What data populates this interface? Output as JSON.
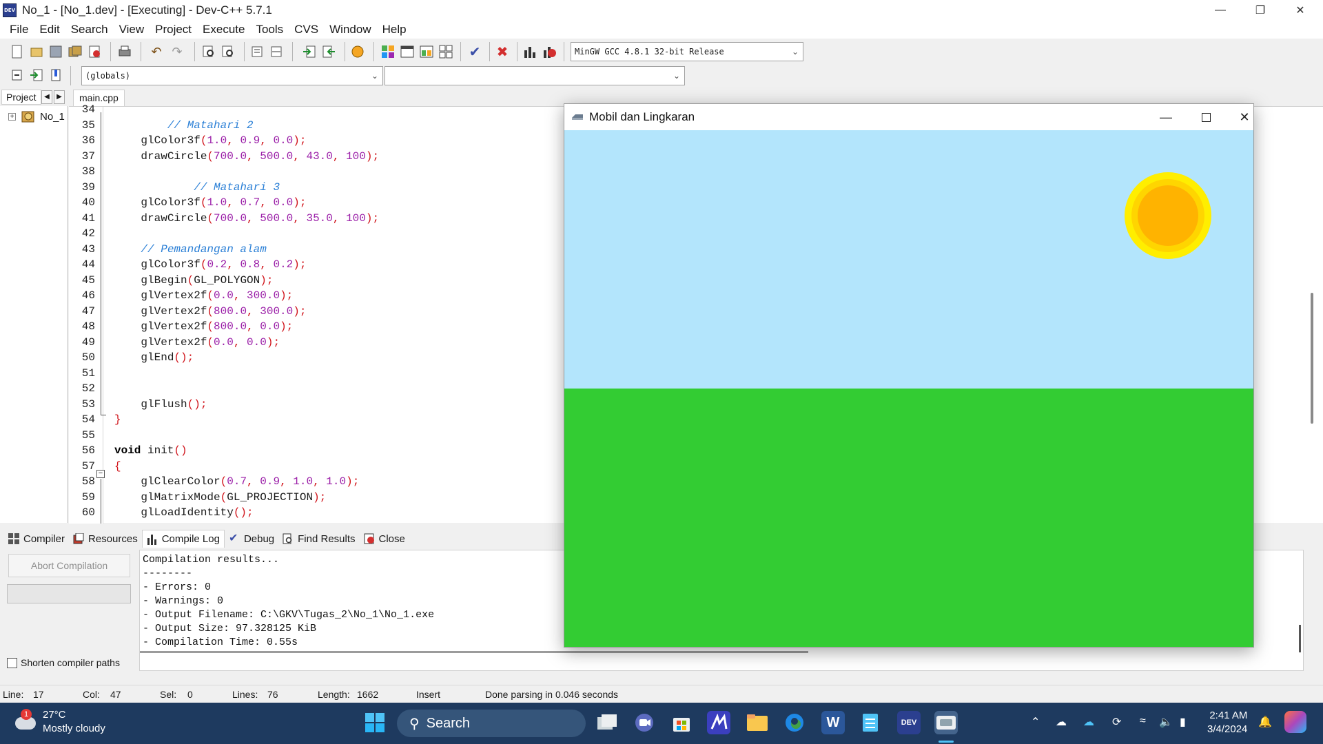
{
  "window": {
    "title": "No_1 - [No_1.dev] - [Executing] - Dev-C++ 5.7.1",
    "app_icon_text": "DEV"
  },
  "menu": [
    "File",
    "Edit",
    "Search",
    "View",
    "Project",
    "Execute",
    "Tools",
    "CVS",
    "Window",
    "Help"
  ],
  "toolbar": {
    "compiler_select": "MinGW GCC 4.8.1 32-bit Release",
    "scope_select": "(globals)",
    "member_select": ""
  },
  "project_panel": {
    "tab_label": "Project",
    "tree_root": "No_1"
  },
  "editor": {
    "tab_label": "main.cpp",
    "lines": [
      {
        "n": "34",
        "parts": []
      },
      {
        "n": "35",
        "parts": [
          {
            "t": "        // Matahari 2",
            "c": "cmt"
          }
        ]
      },
      {
        "n": "36",
        "parts": [
          {
            "t": "    glColor3f",
            "c": ""
          },
          {
            "t": "(",
            "c": "sym"
          },
          {
            "t": "1.0",
            "c": "num"
          },
          {
            "t": ", ",
            "c": "sym"
          },
          {
            "t": "0.9",
            "c": "num"
          },
          {
            "t": ", ",
            "c": "sym"
          },
          {
            "t": "0.0",
            "c": "num"
          },
          {
            "t": ");",
            "c": "sym"
          }
        ]
      },
      {
        "n": "37",
        "parts": [
          {
            "t": "    drawCircle",
            "c": ""
          },
          {
            "t": "(",
            "c": "sym"
          },
          {
            "t": "700.0",
            "c": "num"
          },
          {
            "t": ", ",
            "c": "sym"
          },
          {
            "t": "500.0",
            "c": "num"
          },
          {
            "t": ", ",
            "c": "sym"
          },
          {
            "t": "43.0",
            "c": "num"
          },
          {
            "t": ", ",
            "c": "sym"
          },
          {
            "t": "100",
            "c": "num"
          },
          {
            "t": ");",
            "c": "sym"
          }
        ]
      },
      {
        "n": "38",
        "parts": []
      },
      {
        "n": "39",
        "parts": [
          {
            "t": "            // Matahari 3",
            "c": "cmt"
          }
        ]
      },
      {
        "n": "40",
        "parts": [
          {
            "t": "    glColor3f",
            "c": ""
          },
          {
            "t": "(",
            "c": "sym"
          },
          {
            "t": "1.0",
            "c": "num"
          },
          {
            "t": ", ",
            "c": "sym"
          },
          {
            "t": "0.7",
            "c": "num"
          },
          {
            "t": ", ",
            "c": "sym"
          },
          {
            "t": "0.0",
            "c": "num"
          },
          {
            "t": ");",
            "c": "sym"
          }
        ]
      },
      {
        "n": "41",
        "parts": [
          {
            "t": "    drawCircle",
            "c": ""
          },
          {
            "t": "(",
            "c": "sym"
          },
          {
            "t": "700.0",
            "c": "num"
          },
          {
            "t": ", ",
            "c": "sym"
          },
          {
            "t": "500.0",
            "c": "num"
          },
          {
            "t": ", ",
            "c": "sym"
          },
          {
            "t": "35.0",
            "c": "num"
          },
          {
            "t": ", ",
            "c": "sym"
          },
          {
            "t": "100",
            "c": "num"
          },
          {
            "t": ");",
            "c": "sym"
          }
        ]
      },
      {
        "n": "42",
        "parts": []
      },
      {
        "n": "43",
        "parts": [
          {
            "t": "    // Pemandangan alam",
            "c": "cmt"
          }
        ]
      },
      {
        "n": "44",
        "parts": [
          {
            "t": "    glColor3f",
            "c": ""
          },
          {
            "t": "(",
            "c": "sym"
          },
          {
            "t": "0.2",
            "c": "num"
          },
          {
            "t": ", ",
            "c": "sym"
          },
          {
            "t": "0.8",
            "c": "num"
          },
          {
            "t": ", ",
            "c": "sym"
          },
          {
            "t": "0.2",
            "c": "num"
          },
          {
            "t": ");",
            "c": "sym"
          }
        ]
      },
      {
        "n": "45",
        "parts": [
          {
            "t": "    glBegin",
            "c": ""
          },
          {
            "t": "(",
            "c": "sym"
          },
          {
            "t": "GL_POLYGON",
            "c": ""
          },
          {
            "t": ");",
            "c": "sym"
          }
        ]
      },
      {
        "n": "46",
        "parts": [
          {
            "t": "    glVertex2f",
            "c": ""
          },
          {
            "t": "(",
            "c": "sym"
          },
          {
            "t": "0.0",
            "c": "num"
          },
          {
            "t": ", ",
            "c": "sym"
          },
          {
            "t": "300.0",
            "c": "num"
          },
          {
            "t": ");",
            "c": "sym"
          }
        ]
      },
      {
        "n": "47",
        "parts": [
          {
            "t": "    glVertex2f",
            "c": ""
          },
          {
            "t": "(",
            "c": "sym"
          },
          {
            "t": "800.0",
            "c": "num"
          },
          {
            "t": ", ",
            "c": "sym"
          },
          {
            "t": "300.0",
            "c": "num"
          },
          {
            "t": ");",
            "c": "sym"
          }
        ]
      },
      {
        "n": "48",
        "parts": [
          {
            "t": "    glVertex2f",
            "c": ""
          },
          {
            "t": "(",
            "c": "sym"
          },
          {
            "t": "800.0",
            "c": "num"
          },
          {
            "t": ", ",
            "c": "sym"
          },
          {
            "t": "0.0",
            "c": "num"
          },
          {
            "t": ");",
            "c": "sym"
          }
        ]
      },
      {
        "n": "49",
        "parts": [
          {
            "t": "    glVertex2f",
            "c": ""
          },
          {
            "t": "(",
            "c": "sym"
          },
          {
            "t": "0.0",
            "c": "num"
          },
          {
            "t": ", ",
            "c": "sym"
          },
          {
            "t": "0.0",
            "c": "num"
          },
          {
            "t": ");",
            "c": "sym"
          }
        ]
      },
      {
        "n": "50",
        "parts": [
          {
            "t": "    glEnd",
            "c": ""
          },
          {
            "t": "();",
            "c": "sym"
          }
        ]
      },
      {
        "n": "51",
        "parts": []
      },
      {
        "n": "52",
        "parts": []
      },
      {
        "n": "53",
        "parts": [
          {
            "t": "    glFlush",
            "c": ""
          },
          {
            "t": "();",
            "c": "sym"
          }
        ]
      },
      {
        "n": "54",
        "parts": [
          {
            "t": "}",
            "c": "sym"
          }
        ]
      },
      {
        "n": "55",
        "parts": []
      },
      {
        "n": "56",
        "parts": [
          {
            "t": "void",
            "c": "kw"
          },
          {
            "t": " init",
            "c": ""
          },
          {
            "t": "()",
            "c": "sym"
          }
        ]
      },
      {
        "n": "57",
        "parts": [
          {
            "t": "{",
            "c": "sym"
          }
        ]
      },
      {
        "n": "58",
        "parts": [
          {
            "t": "    glClearColor",
            "c": ""
          },
          {
            "t": "(",
            "c": "sym"
          },
          {
            "t": "0.7",
            "c": "num"
          },
          {
            "t": ", ",
            "c": "sym"
          },
          {
            "t": "0.9",
            "c": "num"
          },
          {
            "t": ", ",
            "c": "sym"
          },
          {
            "t": "1.0",
            "c": "num"
          },
          {
            "t": ", ",
            "c": "sym"
          },
          {
            "t": "1.0",
            "c": "num"
          },
          {
            "t": ");",
            "c": "sym"
          }
        ]
      },
      {
        "n": "59",
        "parts": [
          {
            "t": "    glMatrixMode",
            "c": ""
          },
          {
            "t": "(",
            "c": "sym"
          },
          {
            "t": "GL_PROJECTION",
            "c": ""
          },
          {
            "t": ");",
            "c": "sym"
          }
        ]
      },
      {
        "n": "60",
        "parts": [
          {
            "t": "    glLoadIdentity",
            "c": ""
          },
          {
            "t": "();",
            "c": "sym"
          }
        ]
      }
    ]
  },
  "bottom_tabs": [
    "Compiler",
    "Resources",
    "Compile Log",
    "Debug",
    "Find Results",
    "Close"
  ],
  "compile_panel": {
    "abort_label": "Abort Compilation",
    "shorten_label": "Shorten compiler paths",
    "log": [
      "Compilation results...",
      "--------",
      "- Errors: 0",
      "- Warnings: 0",
      "- Output Filename: C:\\GKV\\Tugas_2\\No_1\\No_1.exe",
      "- Output Size: 97.328125 KiB",
      "- Compilation Time: 0.55s"
    ]
  },
  "statusbar": {
    "line_label": "Line:",
    "line_value": "17",
    "col_label": "Col:",
    "col_value": "47",
    "sel_label": "Sel:",
    "sel_value": "0",
    "lines_label": "Lines:",
    "lines_value": "76",
    "length_label": "Length:",
    "length_value": "1662",
    "mode": "Insert",
    "message": "Done parsing in 0.046 seconds"
  },
  "gl_window": {
    "title": "Mobil dan Lingkaran",
    "sky_color": "#b3e5fc",
    "ground_color": "#33cc33",
    "sun_colors": [
      "#ffee00",
      "#ffd500",
      "#ffb300"
    ]
  },
  "taskbar": {
    "weather_temp": "27°C",
    "weather_desc": "Mostly cloudy",
    "weather_badge": "1",
    "search_label": "Search",
    "clock_time": "2:41 AM",
    "clock_date": "3/4/2024",
    "devcpp_label": "DEV"
  }
}
